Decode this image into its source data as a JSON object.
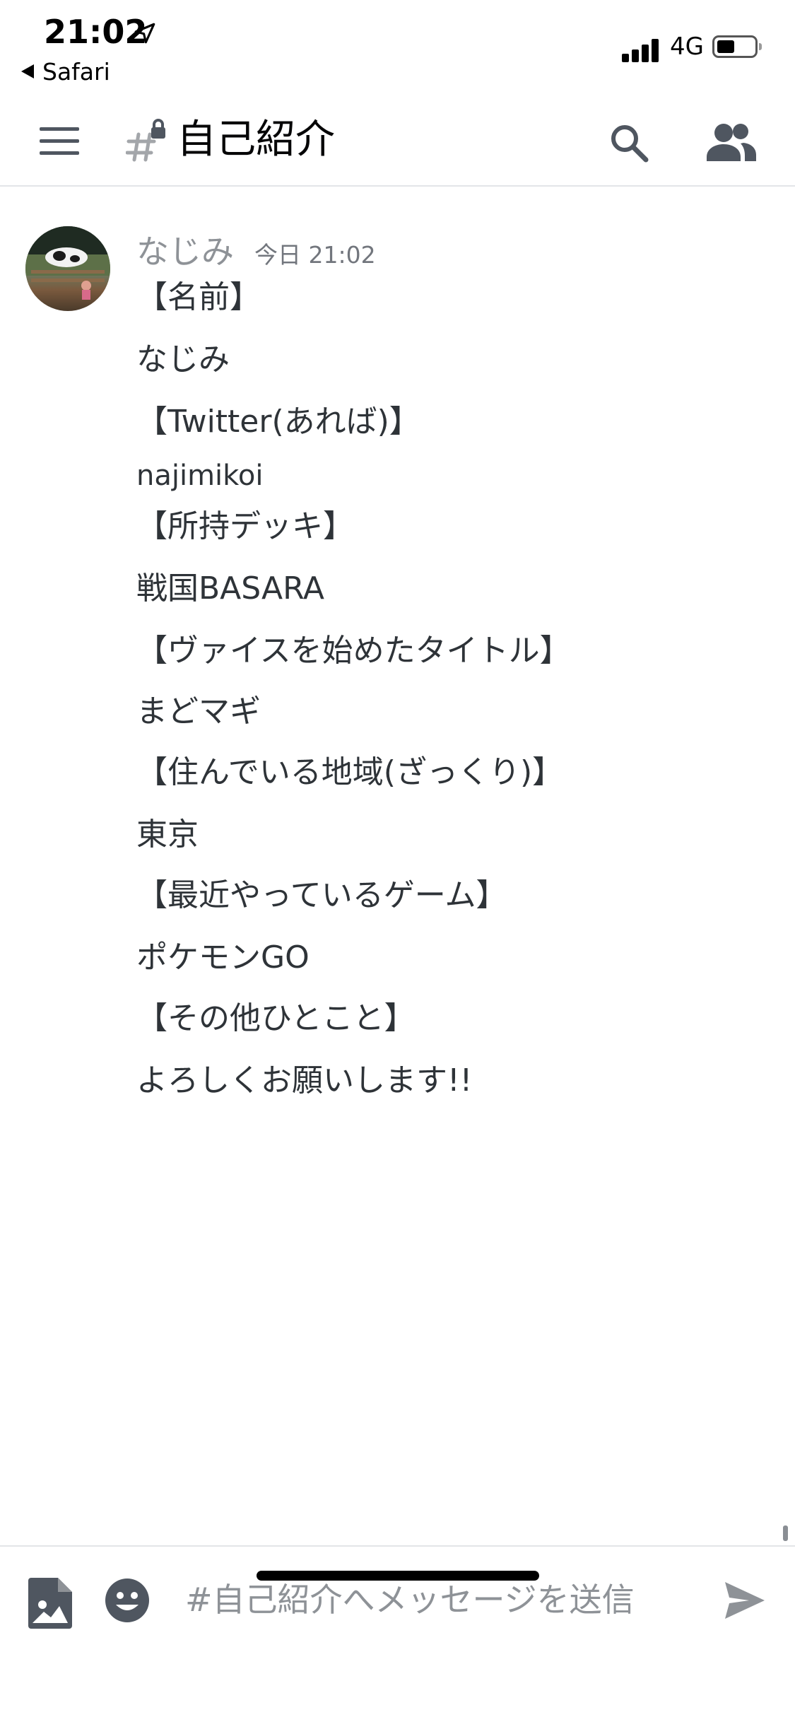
{
  "status_bar": {
    "time": "21:02",
    "back_app": "Safari",
    "network": "4G"
  },
  "header": {
    "channel_name": "自己紹介"
  },
  "message": {
    "author": "なじみ",
    "timestamp": "今日 21:02",
    "lines": [
      "【名前】",
      "なじみ",
      "【Twitter(あれば)】",
      "najimikoi",
      "【所持デッキ】",
      "戦国BASARA",
      "【ヴァイスを始めたタイトル】",
      "まどマギ",
      "【住んでいる地域(ざっくり)】",
      "東京",
      "【最近やっているゲーム】",
      "ポケモンGO",
      "【その他ひとこと】",
      "よろしくお願いします!!"
    ]
  },
  "composer": {
    "placeholder": "#自己紹介へメッセージを送信"
  },
  "colors": {
    "text": "#2e3338",
    "muted": "#8e9297",
    "icon": "#4f5660",
    "divider": "#e3e5e8"
  }
}
